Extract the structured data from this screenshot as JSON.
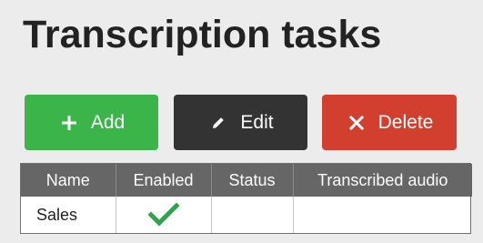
{
  "page": {
    "title": "Transcription tasks"
  },
  "toolbar": {
    "add_label": "Add",
    "edit_label": "Edit",
    "delete_label": "Delete"
  },
  "colors": {
    "add": "#3bb54a",
    "edit": "#333333",
    "delete": "#d33f2f",
    "check": "#2fa44a",
    "table_header": "#666666"
  },
  "icons": {
    "add": "plus-icon",
    "edit": "pencil-icon",
    "delete": "close-icon",
    "enabled": "checkmark-icon"
  },
  "table": {
    "columns": [
      "Name",
      "Enabled",
      "Status",
      "Transcribed audio"
    ],
    "rows": [
      {
        "name": "Sales",
        "enabled": true,
        "status": "",
        "transcribed_audio": ""
      }
    ]
  }
}
